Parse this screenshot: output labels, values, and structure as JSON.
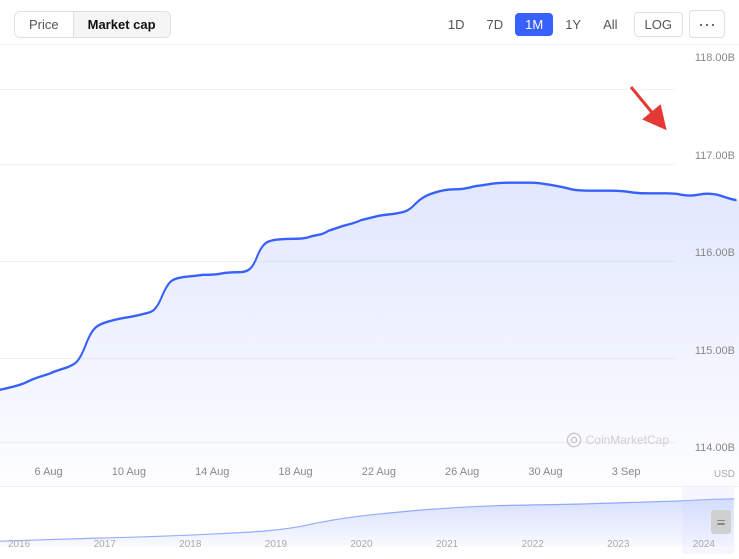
{
  "toolbar": {
    "tabs": [
      {
        "id": "price",
        "label": "Price",
        "active": false
      },
      {
        "id": "market-cap",
        "label": "Market cap",
        "active": true
      }
    ],
    "timeButtons": [
      {
        "id": "1d",
        "label": "1D",
        "active": false
      },
      {
        "id": "7d",
        "label": "7D",
        "active": false
      },
      {
        "id": "1m",
        "label": "1M",
        "active": true
      },
      {
        "id": "1y",
        "label": "1Y",
        "active": false
      },
      {
        "id": "all",
        "label": "All",
        "active": false
      }
    ],
    "logButton": "LOG",
    "moreButton": "···"
  },
  "chart": {
    "yAxisLabels": [
      "118.00B",
      "117.00B",
      "116.00B",
      "115.00B",
      "114.00B"
    ],
    "xAxisLabels": [
      "6 Aug",
      "10 Aug",
      "14 Aug",
      "18 Aug",
      "22 Aug",
      "26 Aug",
      "30 Aug",
      "3 Sep"
    ],
    "currency": "USD",
    "watermark": "CoinMarketCap"
  },
  "miniChart": {
    "xAxisLabels": [
      "2016",
      "2017",
      "2018",
      "2019",
      "2020",
      "2021",
      "2022",
      "2023",
      "2024"
    ]
  },
  "colors": {
    "accent": "#3861fb",
    "line": "#3861fb",
    "fill": "rgba(56,97,251,0.08)",
    "red": "#e53935"
  }
}
